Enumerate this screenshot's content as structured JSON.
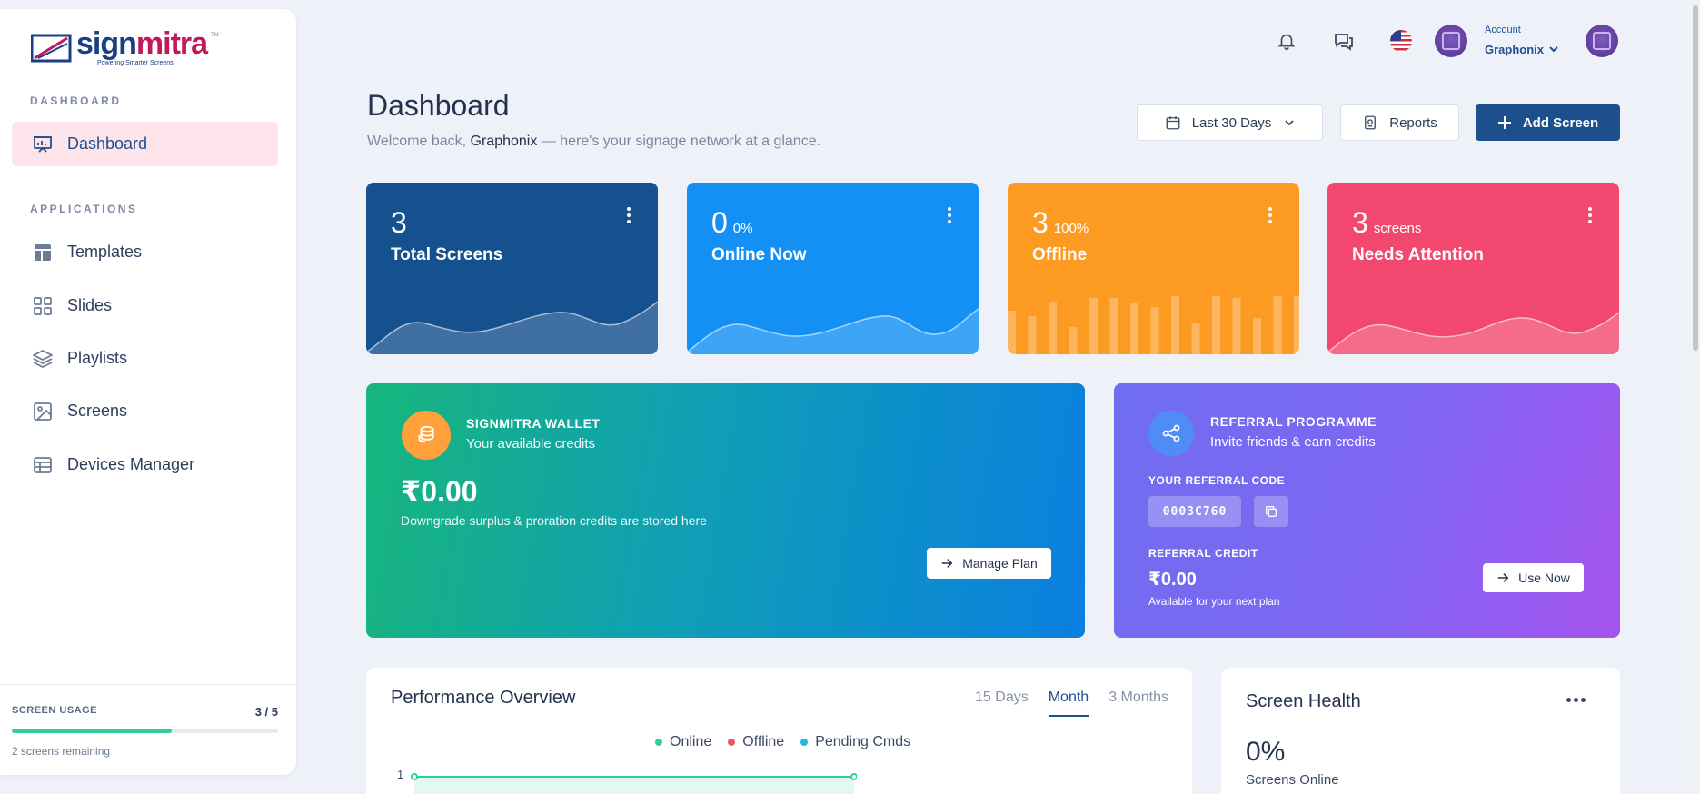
{
  "brand": {
    "logo_text_1": "sign",
    "logo_text_2": "mitra",
    "tagline": "Powering Smarter Screens",
    "tm": "TM"
  },
  "sidebar": {
    "sections": {
      "dashboard": "DASHBOARD",
      "applications": "APPLICATIONS"
    },
    "items": [
      {
        "label": "Dashboard",
        "icon": "presentation-board-icon",
        "active": true
      },
      {
        "label": "Templates",
        "icon": "layout-template-icon"
      },
      {
        "label": "Slides",
        "icon": "grid-icon"
      },
      {
        "label": "Playlists",
        "icon": "layers-icon"
      },
      {
        "label": "Screens",
        "icon": "image-icon"
      },
      {
        "label": "Devices Manager",
        "icon": "table-icon"
      }
    ],
    "usage": {
      "label": "SCREEN USAGE",
      "count": "3 / 5",
      "fraction": 0.6,
      "remaining": "2 screens remaining"
    }
  },
  "topbar": {
    "account_label": "Account",
    "account_name": "Graphonix"
  },
  "header": {
    "title": "Dashboard",
    "welcome_prefix": "Welcome back,",
    "welcome_name": "Graphonix",
    "welcome_suffix": "— here's your signage network at a glance.",
    "date_range": "Last 30 Days",
    "reports_label": "Reports",
    "add_screen_label": "Add Screen"
  },
  "stats": [
    {
      "value": "3",
      "suffix": "",
      "label": "Total Screens",
      "color": "#16518f"
    },
    {
      "value": "0",
      "suffix": "0%",
      "label": "Online Now",
      "color": "#1490f5"
    },
    {
      "value": "3",
      "suffix": "100%",
      "label": "Offline",
      "color": "#fd9a22"
    },
    {
      "value": "3",
      "suffix": "screens",
      "label": "Needs Attention",
      "color": "#f2476f"
    }
  ],
  "wallet": {
    "title": "SIGNMITRA WALLET",
    "subtitle": "Your available credits",
    "amount": "₹0.00",
    "note": "Downgrade surplus & proration credits are stored here",
    "button": "Manage Plan"
  },
  "referral": {
    "title": "REFERRAL PROGRAMME",
    "subtitle": "Invite friends & earn credits",
    "code_label": "YOUR REFERRAL CODE",
    "code": "0003C760",
    "credit_label": "REFERRAL CREDIT",
    "credit": "₹0.00",
    "credit_note": "Available for your next plan",
    "button": "Use Now"
  },
  "performance": {
    "title": "Performance Overview",
    "tabs": [
      "15 Days",
      "Month",
      "3 Months"
    ],
    "active_tab": "Month",
    "legend": [
      {
        "name": "Online",
        "color": "#2fd19a"
      },
      {
        "name": "Offline",
        "color": "#f0575c"
      },
      {
        "name": "Pending Cmds",
        "color": "#25b8d6"
      }
    ],
    "y_tick": "1"
  },
  "health": {
    "title": "Screen Health",
    "percent": "0%",
    "subtitle": "Screens Online"
  }
}
